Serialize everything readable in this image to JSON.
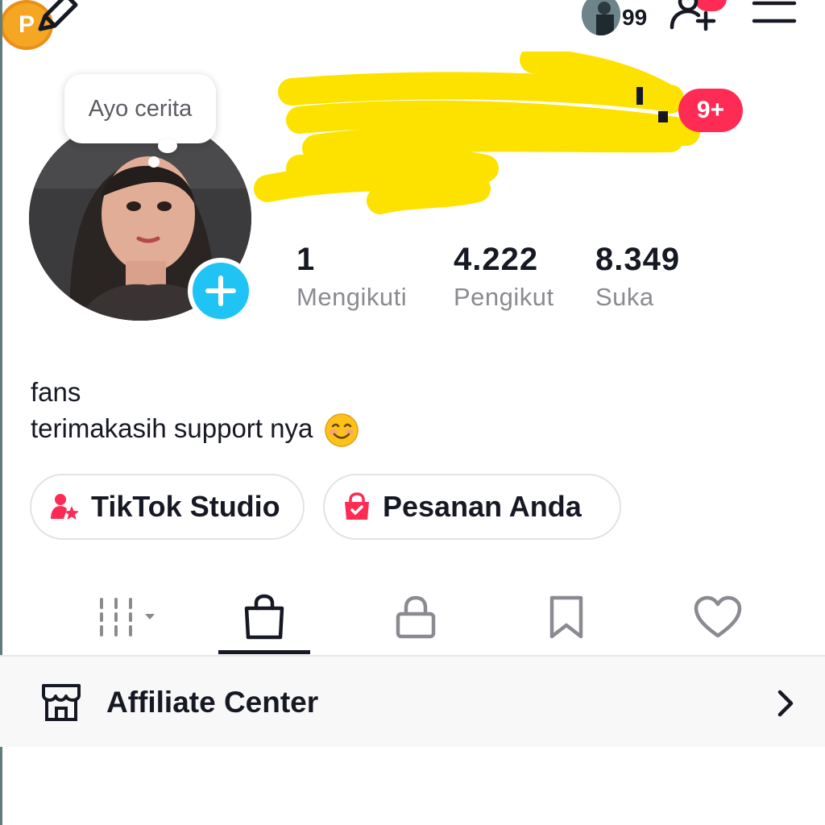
{
  "topbar": {
    "coin_letter": "P",
    "friends_count": "99"
  },
  "profile": {
    "story_prompt": "Ayo cerita",
    "notification_badge": "9+",
    "stats": [
      {
        "value": "1",
        "label": "Mengikuti"
      },
      {
        "value": "4.222",
        "label": "Pengikut"
      },
      {
        "value": "8.349",
        "label": "Suka"
      }
    ],
    "bio_line1": "fans",
    "bio_line2": "terimakasih support nya"
  },
  "buttons": {
    "studio": "TikTok Studio",
    "orders": "Pesanan Anda"
  },
  "tabs": [
    {
      "icon": "grid-icon",
      "active": false
    },
    {
      "icon": "shopping-bag-icon",
      "active": true
    },
    {
      "icon": "lock-icon",
      "active": false
    },
    {
      "icon": "bookmark-icon",
      "active": false
    },
    {
      "icon": "heart-icon",
      "active": false
    }
  ],
  "affiliate": {
    "label": "Affiliate Center"
  },
  "colors": {
    "accent_red": "#fe2c55",
    "add_blue": "#20c4f4",
    "coin_orange": "#f5a623",
    "scribble_yellow": "#fde200"
  }
}
